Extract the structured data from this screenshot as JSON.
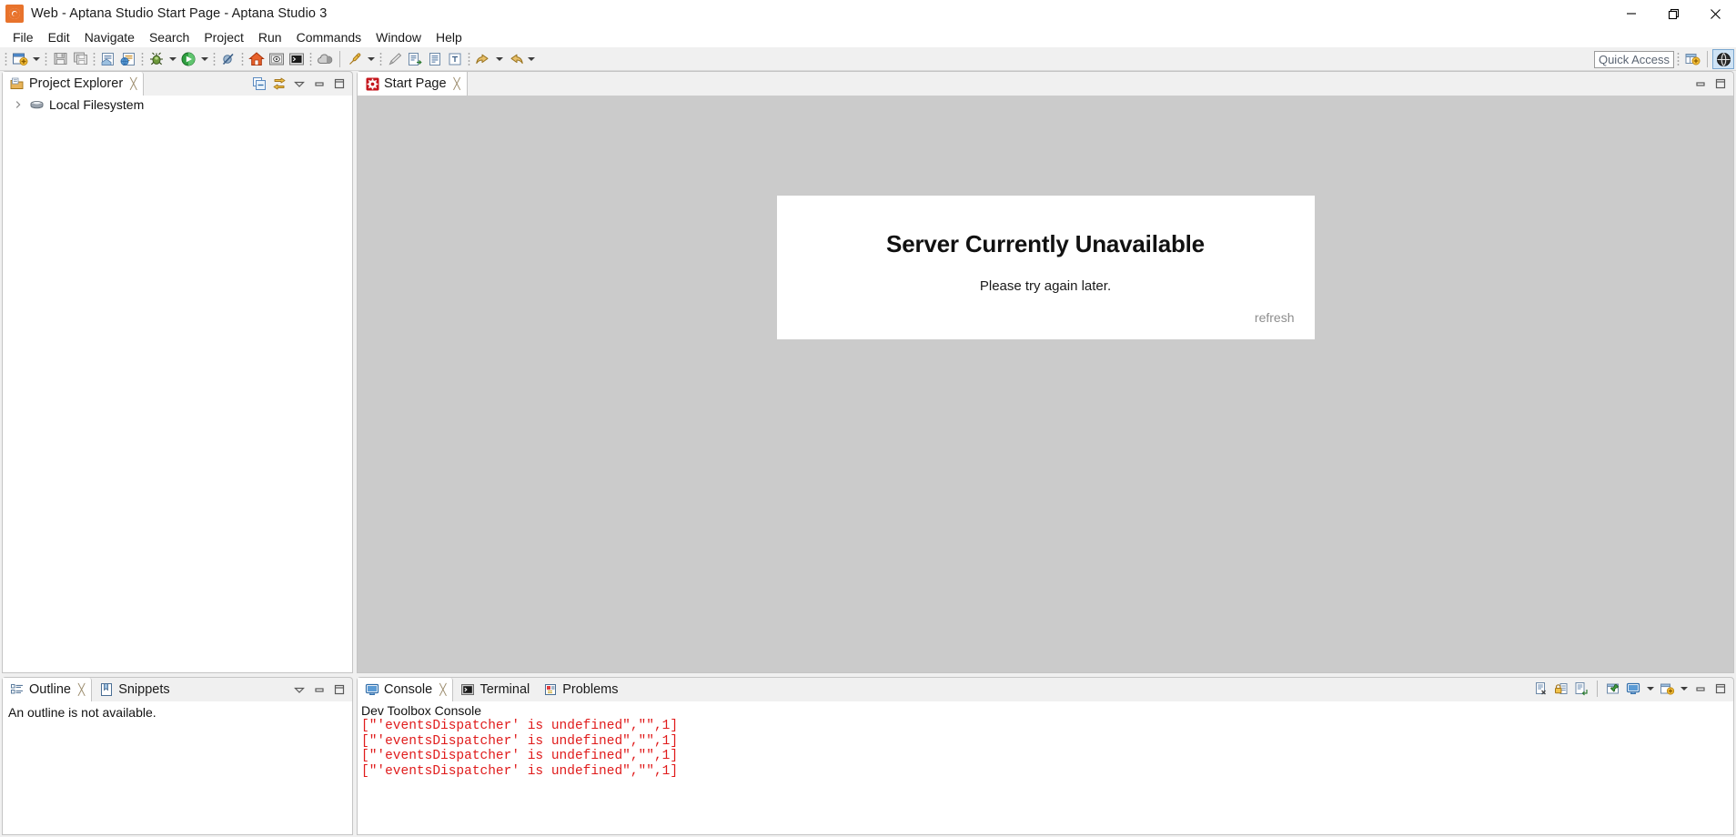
{
  "window": {
    "title": "Web - Aptana Studio Start Page - Aptana Studio 3",
    "app_icon": "aptana-gear-icon",
    "minimize_label": "—",
    "maximize_label": "❐",
    "close_label": "✕"
  },
  "menubar": {
    "items": [
      {
        "label": "File"
      },
      {
        "label": "Edit"
      },
      {
        "label": "Navigate"
      },
      {
        "label": "Search"
      },
      {
        "label": "Project"
      },
      {
        "label": "Run"
      },
      {
        "label": "Commands"
      },
      {
        "label": "Window"
      },
      {
        "label": "Help"
      }
    ]
  },
  "toolbar": {
    "buttons": [
      {
        "name": "new-wizard-icon",
        "has_dropdown": true
      },
      {
        "name": "save-icon",
        "has_dropdown": false
      },
      {
        "name": "save-all-icon",
        "has_dropdown": false
      },
      {
        "name": "open-file-icon",
        "has_dropdown": false
      },
      {
        "name": "open-web-file-icon",
        "has_dropdown": false
      },
      {
        "name": "debug-bug-icon",
        "has_dropdown": true
      },
      {
        "name": "run-icon",
        "has_dropdown": true
      },
      {
        "name": "skip-breakpoints-icon",
        "has_dropdown": false
      },
      {
        "name": "home-icon",
        "has_dropdown": false
      },
      {
        "name": "preview-icon",
        "has_dropdown": false
      },
      {
        "name": "terminal-icon",
        "has_dropdown": false
      },
      {
        "name": "deploy-cloud-icon",
        "has_dropdown": false
      },
      {
        "name": "external-tools-icon",
        "has_dropdown": true
      },
      {
        "name": "search-pencil-icon",
        "has_dropdown": false
      },
      {
        "name": "next-annotation-icon",
        "has_dropdown": false
      },
      {
        "name": "previous-edit-icon",
        "has_dropdown": false
      },
      {
        "name": "toggle-mark-icon",
        "has_dropdown": false
      },
      {
        "name": "back-icon",
        "has_dropdown": true
      },
      {
        "name": "forward-icon",
        "has_dropdown": true
      }
    ],
    "quick_access_placeholder": "Quick Access",
    "new-perspective-icon": "new-perspective-icon",
    "perspective-web-icon": "perspective-web-icon"
  },
  "project_explorer": {
    "tabs": [
      {
        "label": "Project Explorer",
        "icon": "project-explorer-icon",
        "active": true,
        "closable": true
      }
    ],
    "toolbar": [
      {
        "name": "collapse-all-icon"
      },
      {
        "name": "link-with-editor-icon"
      },
      {
        "name": "view-menu-icon"
      },
      {
        "name": "minimize-view-icon"
      },
      {
        "name": "maximize-view-icon"
      }
    ],
    "tree": [
      {
        "label": "Local Filesystem",
        "icon": "filesystem-drive-icon",
        "expanded": false
      }
    ]
  },
  "outline_panel": {
    "tabs": [
      {
        "label": "Outline",
        "icon": "outline-icon",
        "active": true,
        "closable": true
      },
      {
        "label": "Snippets",
        "icon": "snippets-icon",
        "active": false,
        "closable": false
      }
    ],
    "toolbar": [
      {
        "name": "view-menu-icon"
      },
      {
        "name": "minimize-view-icon"
      },
      {
        "name": "maximize-view-icon"
      }
    ],
    "message": "An outline is not available."
  },
  "editor": {
    "tabs": [
      {
        "label": "Start Page",
        "icon": "start-page-icon",
        "active": true,
        "closable": true
      }
    ],
    "toolbar": [
      {
        "name": "minimize-view-icon"
      },
      {
        "name": "maximize-view-icon"
      }
    ],
    "error_card": {
      "title": "Server Currently Unavailable",
      "subtitle": "Please try again later.",
      "refresh_label": "refresh"
    }
  },
  "console_panel": {
    "tabs": [
      {
        "label": "Console",
        "icon": "console-icon",
        "active": true,
        "closable": true
      },
      {
        "label": "Terminal",
        "icon": "terminal-icon",
        "active": false,
        "closable": false
      },
      {
        "label": "Problems",
        "icon": "problems-icon",
        "active": false,
        "closable": false
      }
    ],
    "toolbar": [
      {
        "name": "clear-console-icon"
      },
      {
        "name": "scroll-lock-icon"
      },
      {
        "name": "show-console-on-output-icon"
      },
      {
        "name": "pin-console-icon"
      },
      {
        "name": "display-selected-console-icon",
        "has_dropdown": true
      },
      {
        "name": "open-console-icon",
        "has_dropdown": true
      },
      {
        "name": "minimize-view-icon"
      },
      {
        "name": "maximize-view-icon"
      }
    ],
    "header": "Dev Toolbox Console",
    "lines": [
      "[\"'eventsDispatcher' is undefined\",\"\",1]",
      "[\"'eventsDispatcher' is undefined\",\"\",1]",
      "[\"'eventsDispatcher' is undefined\",\"\",1]",
      "[\"'eventsDispatcher' is undefined\",\"\",1]"
    ]
  },
  "colors": {
    "titlebar_bg": "#ffffff",
    "toolbar_bg": "#f0f0f0",
    "editor_bg": "#cbcbcb",
    "console_text": "#e01b1b",
    "accent_orange": "#e8732c",
    "tab_active_bg": "#ffffff",
    "border": "#c4c4c4"
  }
}
